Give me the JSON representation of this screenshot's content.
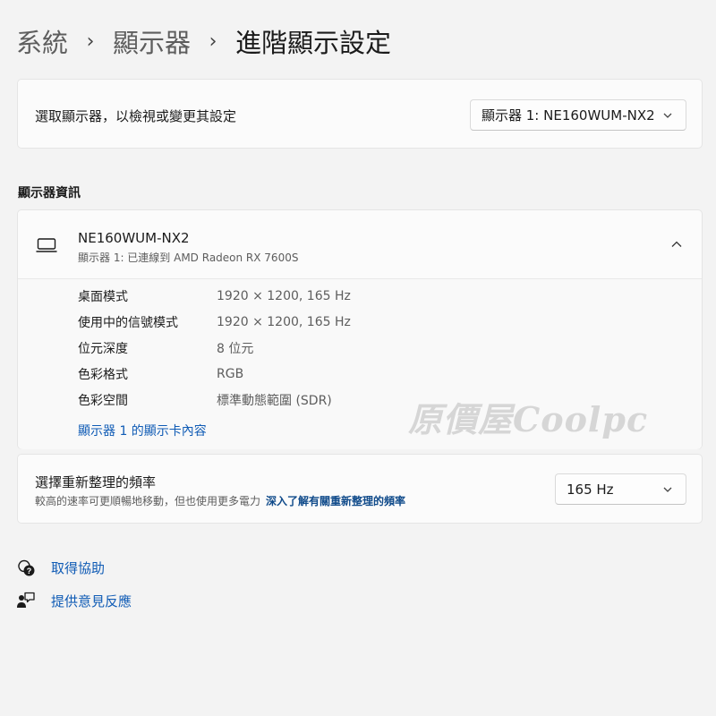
{
  "breadcrumb": {
    "items": [
      "系統",
      "顯示器"
    ],
    "separator": "›",
    "current": "進階顯示設定"
  },
  "display_select": {
    "label": "選取顯示器，以檢視或變更其設定",
    "selected": "顯示器 1: NE160WUM-NX2"
  },
  "display_info": {
    "section_title": "顯示器資訊",
    "name": "NE160WUM-NX2",
    "subtitle": "顯示器 1: 已連線到 AMD Radeon RX 7600S",
    "expanded": true,
    "specs": [
      {
        "key": "桌面模式",
        "value": "1920 × 1200, 165 Hz"
      },
      {
        "key": "使用中的信號模式",
        "value": "1920 × 1200, 165 Hz"
      },
      {
        "key": "位元深度",
        "value": "8 位元"
      },
      {
        "key": "色彩格式",
        "value": "RGB"
      },
      {
        "key": "色彩空間",
        "value": "標準動態範圍 (SDR)"
      }
    ],
    "adapter_link": "顯示器 1 的顯示卡內容"
  },
  "refresh_rate": {
    "title": "選擇重新整理的頻率",
    "description": "較高的速率可更順暢地移動，但也使用更多電力",
    "learn_more": "深入了解有關重新整理的頻率",
    "selected": "165 Hz"
  },
  "footer_links": {
    "help": "取得協助",
    "feedback": "提供意見反應"
  },
  "watermark": "原價屋Coolpc",
  "colors": {
    "background": "#f3f3f3",
    "card": "#fbfbfb",
    "link": "#0f5bb5",
    "accent_dark": "#0f4a8a"
  },
  "icons": [
    "chevron-right-icon",
    "chevron-down-icon",
    "chevron-up-icon",
    "laptop-icon",
    "help-icon",
    "feedback-icon"
  ]
}
